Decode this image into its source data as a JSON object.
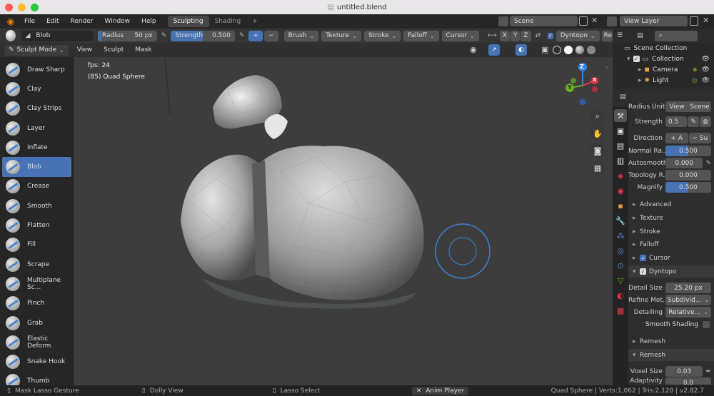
{
  "window": {
    "title": "untitled.blend"
  },
  "menubar": {
    "items": [
      "File",
      "Edit",
      "Render",
      "Window",
      "Help"
    ],
    "workspaces": [
      "Sculpting",
      "Shading"
    ],
    "add": "+",
    "scene": "Scene",
    "view_layer": "View Layer"
  },
  "toolheader": {
    "brush_name": "Blob",
    "radius_label": "Radius",
    "radius_value": "50 px",
    "strength_label": "Strength",
    "strength_value": "0.500",
    "plus": "+",
    "minus": "−",
    "menus": [
      "Brush",
      "Texture",
      "Stroke",
      "Falloff",
      "Cursor"
    ],
    "axes": [
      "X",
      "Y",
      "Z"
    ],
    "dyntopo": "Dyntopo",
    "re": "Re"
  },
  "modeheader": {
    "mode": "Sculpt Mode",
    "menus": [
      "View",
      "Sculpt",
      "Mask"
    ]
  },
  "tools": [
    "Draw Sharp",
    "Clay",
    "Clay Strips",
    "Layer",
    "Inflate",
    "Blob",
    "Crease",
    "Smooth",
    "Flatten",
    "Fill",
    "Scrape",
    "Multiplane Sc...",
    "Pinch",
    "Grab",
    "Elastic Deform",
    "Snake Hook",
    "Thumb"
  ],
  "active_tool": "Blob",
  "viewport": {
    "fps": "fps: 24",
    "object": "(85) Quad Sphere"
  },
  "gizmo": {
    "x": "X",
    "y": "Y",
    "z": "Z"
  },
  "outliner": {
    "root": "Scene Collection",
    "collection": "Collection",
    "items": [
      "Camera",
      "Light"
    ]
  },
  "props": {
    "radius_unit_label": "Radius Unit",
    "radius_unit_opts": [
      "View",
      "Scene"
    ],
    "strength_label": "Strength",
    "strength_value": "0.5",
    "direction_label": "Direction",
    "direction_add": "+ A",
    "direction_sub": "− Su",
    "normal_radius_label": "Normal Ra...",
    "normal_radius_value": "0.500",
    "autosmooth_label": "Autosmooth",
    "autosmooth_value": "0.000",
    "topology_label": "Topology R...",
    "topology_value": "0.000",
    "magnify_label": "Magnify",
    "magnify_value": "0.500",
    "sections": [
      "Advanced",
      "Texture",
      "Stroke",
      "Falloff",
      "Cursor"
    ],
    "dyntopo_header": "Dyntopo",
    "detail_size_label": "Detail Size",
    "detail_size_value": "25.20 px",
    "refine_label": "Refine Met...",
    "refine_value": "Subdivid...",
    "detailing_label": "Detailing",
    "detailing_value": "Relative...",
    "smooth_shading": "Smooth Shading",
    "remesh_sub": "Remesh",
    "remesh_header": "Remesh",
    "voxel_label": "Voxel Size",
    "voxel_value": "0.03",
    "adaptivity_label": "Adaptivity",
    "adaptivity_value": "0.0"
  },
  "statusbar": {
    "items": [
      "Mask Lasso Gesture",
      "Dolly View",
      "Lasso Select",
      "Anim Player"
    ],
    "stats": "Quad Sphere | Verts:1,062 | Tris:2,120 | v2.82.7"
  },
  "colors": {
    "accent": "#4772b3",
    "axis_x": "#e5344a",
    "axis_y": "#6ab023",
    "axis_z": "#2f84e3",
    "viewport": "#3d3d3d"
  }
}
